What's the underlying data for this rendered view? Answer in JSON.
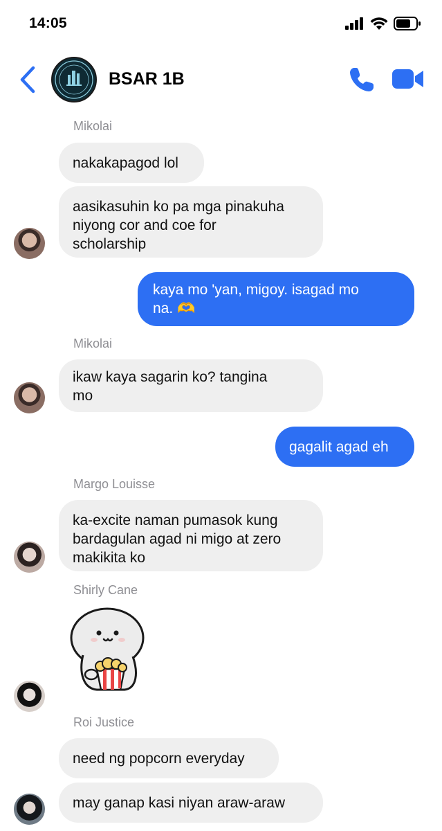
{
  "status_bar": {
    "time": "14:05"
  },
  "header": {
    "title": "BSAR 1B"
  },
  "messages": [
    {
      "sender": "Mikolai",
      "texts": [
        "nakakapagod lol",
        "aasikasuhin ko pa mga pinakuha\nniyong cor and coe for\nscholarship"
      ]
    },
    {
      "outgoing": "kaya mo 'yan, migoy. isagad mo\nna. 🫶"
    },
    {
      "sender": "Mikolai",
      "texts": [
        "ikaw kaya sagarin ko? tangina\nmo"
      ]
    },
    {
      "outgoing": "gagalit agad eh"
    },
    {
      "sender": "Margo Louisse",
      "texts": [
        "ka-excite naman pumasok kung\nbardagulan agad ni migo at zero\nmakikita ko"
      ]
    },
    {
      "sender": "Shirly Cane"
    },
    {
      "sender": "Roi Justice",
      "texts": [
        "need ng popcorn everyday",
        "may ganap kasi niyan araw-araw"
      ]
    }
  ],
  "icons": {
    "signal": "cellular-signal-icon",
    "wifi": "wifi-icon",
    "battery": "battery-icon",
    "back": "chevron-left-icon",
    "call": "phone-icon",
    "video": "video-camera-icon",
    "sticker": "popcorn-sticker-icon"
  },
  "colors": {
    "accent": "#2d6ff3",
    "incoming_bubble": "#efefef",
    "meta_text": "#8e8e93"
  }
}
